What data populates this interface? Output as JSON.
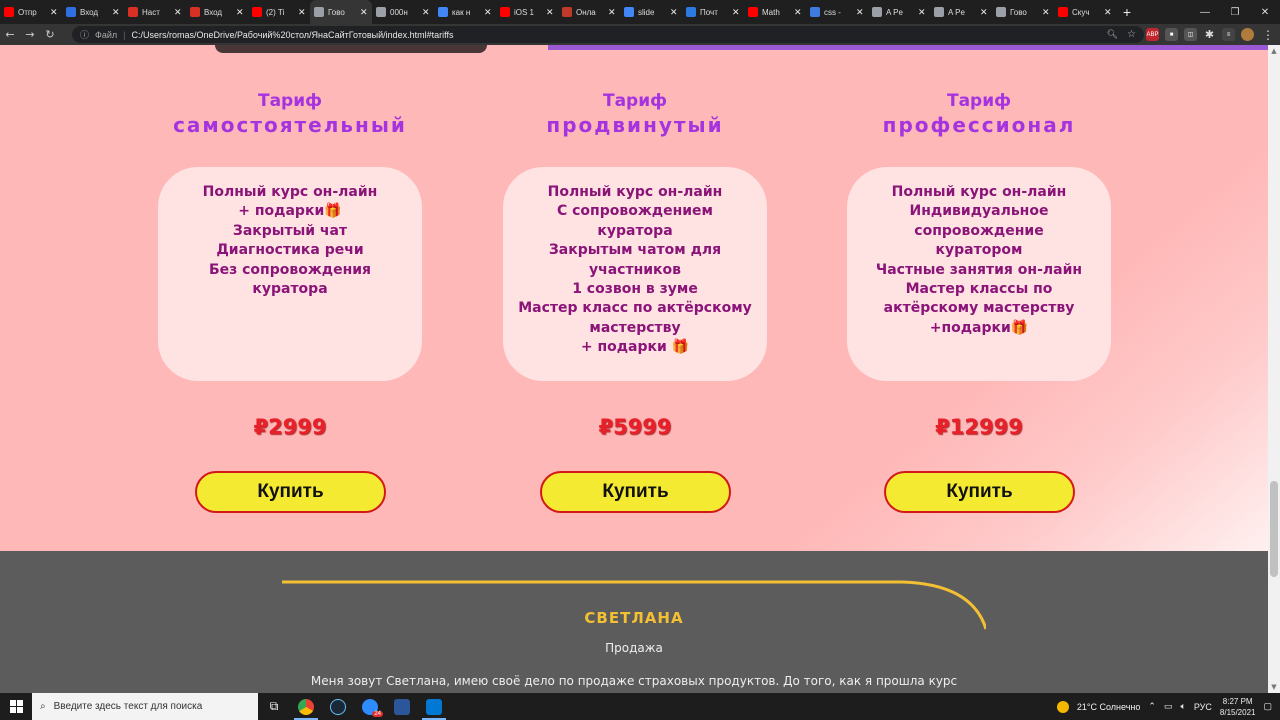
{
  "browser": {
    "tabs": [
      {
        "label": "Отпр",
        "color": "#ff0000"
      },
      {
        "label": "Вход",
        "color": "#2f6fe0"
      },
      {
        "label": "Наст",
        "color": "#d93025"
      },
      {
        "label": "Вход",
        "color": "#d93025"
      },
      {
        "label": "(2) Ti",
        "color": "#ff0000"
      },
      {
        "label": "Гово",
        "color": "#9aa0a6"
      },
      {
        "label": "000н",
        "color": "#9aa0a6"
      },
      {
        "label": "как н",
        "color": "#4285f4"
      },
      {
        "label": "iOS 1",
        "color": "#ff0000"
      },
      {
        "label": "Онла",
        "color": "#c0392b"
      },
      {
        "label": "slide",
        "color": "#4285f4"
      },
      {
        "label": "Почт",
        "color": "#2a7ae2"
      },
      {
        "label": "Math",
        "color": "#ff0000"
      },
      {
        "label": "css -",
        "color": "#3d7be0"
      },
      {
        "label": "A Pe",
        "color": "#9aa0a6"
      },
      {
        "label": "A Pe",
        "color": "#9aa0a6"
      },
      {
        "label": "Гово",
        "color": "#9aa0a6"
      },
      {
        "label": "Скуч",
        "color": "#ff0000"
      }
    ],
    "active_tab": 5,
    "new_tab": "+",
    "url_label": "Файл",
    "url": "C:/Users/romas/OneDrive/Рабочий%20стол/ЯнаСайтГотовый/index.html#tariffs",
    "ext_abp": "ABP"
  },
  "tariffs": [
    {
      "title_small": "Тариф",
      "title_big": "самостоятельный",
      "features": [
        "Полный курс он-лайн",
        "+ подарки🎁",
        "Закрытый чат",
        "Диагностика речи",
        "Без сопровождения",
        "куратора"
      ],
      "price": "₽2999",
      "button": "Купить"
    },
    {
      "title_small": "Тариф",
      "title_big": "продвинутый",
      "features": [
        "Полный курс он-лайн",
        "С сопровождением",
        "куратора",
        "Закрытым чатом для",
        "участников",
        "1 созвон в зуме",
        "Мастер класс по актёрскому",
        "мастерству",
        "+ подарки 🎁"
      ],
      "price": "₽5999",
      "button": "Купить"
    },
    {
      "title_small": "Тариф",
      "title_big": "профессионал",
      "features": [
        "Полный курс он-лайн",
        "Индивидуальное",
        "сопровождение",
        "куратором",
        "Частные занятия он-лайн",
        "Мастер классы по",
        "актёрскому мастерству",
        "+подарки🎁"
      ],
      "price": "₽12999",
      "button": "Купить"
    }
  ],
  "review": {
    "name": "СВЕТЛАНА",
    "role": "Продажа",
    "text": "Меня зовут Светлана, имею своё дело по продаже страховых продуктов. До того, как я прошла курс"
  },
  "taskbar": {
    "search_placeholder": "Введите здесь текст для поиска",
    "weather": "21°C  Солнечно",
    "lang": "РУС",
    "time": "8:27 PM",
    "date": "8/15/2021",
    "badge": "24"
  },
  "colors": {
    "accent_purple": "#a633e0",
    "feature_text": "#8b1478",
    "price_red": "#e8202a",
    "button_yellow": "#f4ea31",
    "gold": "#f4c033"
  }
}
